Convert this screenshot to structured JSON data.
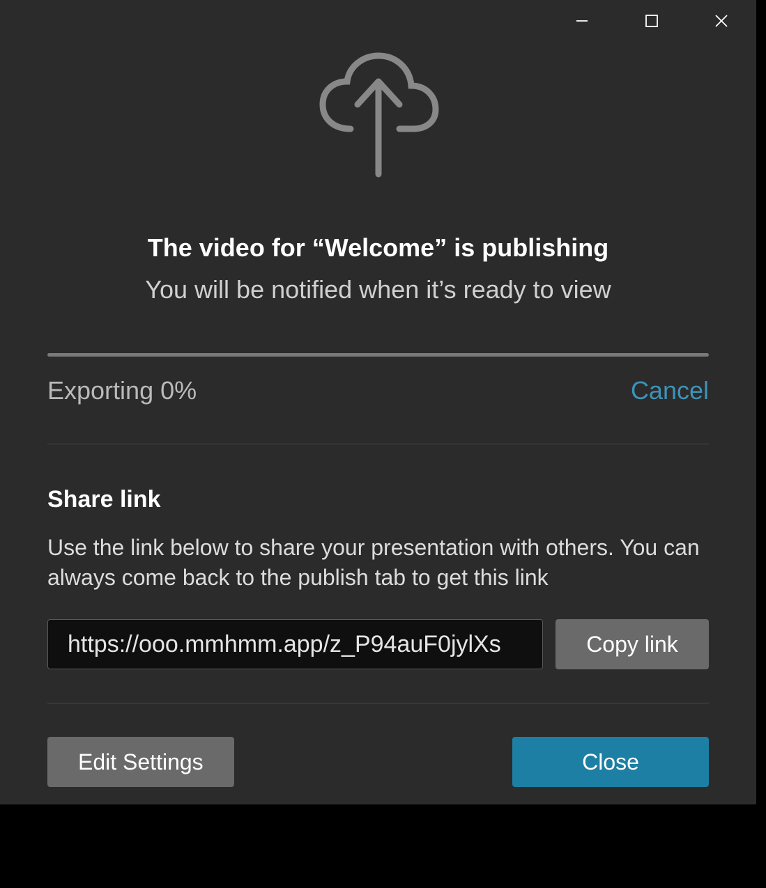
{
  "header": {
    "title": "The video for “Welcome” is publishing",
    "subtitle": "You will be notified when it’s ready to view"
  },
  "progress": {
    "label": "Exporting 0%",
    "percent": 0,
    "cancel_label": "Cancel"
  },
  "share": {
    "heading": "Share link",
    "description": "Use the link below to share your presentation with others. You can always come back to the publish tab to get this link",
    "url": "https://ooo.mmhmm.app/z_P94auF0jylXs",
    "copy_label": "Copy link"
  },
  "footer": {
    "edit_settings_label": "Edit Settings",
    "close_label": "Close"
  },
  "colors": {
    "accent": "#1c7fa3",
    "link": "#3d93b8",
    "background": "#2b2b2b"
  }
}
